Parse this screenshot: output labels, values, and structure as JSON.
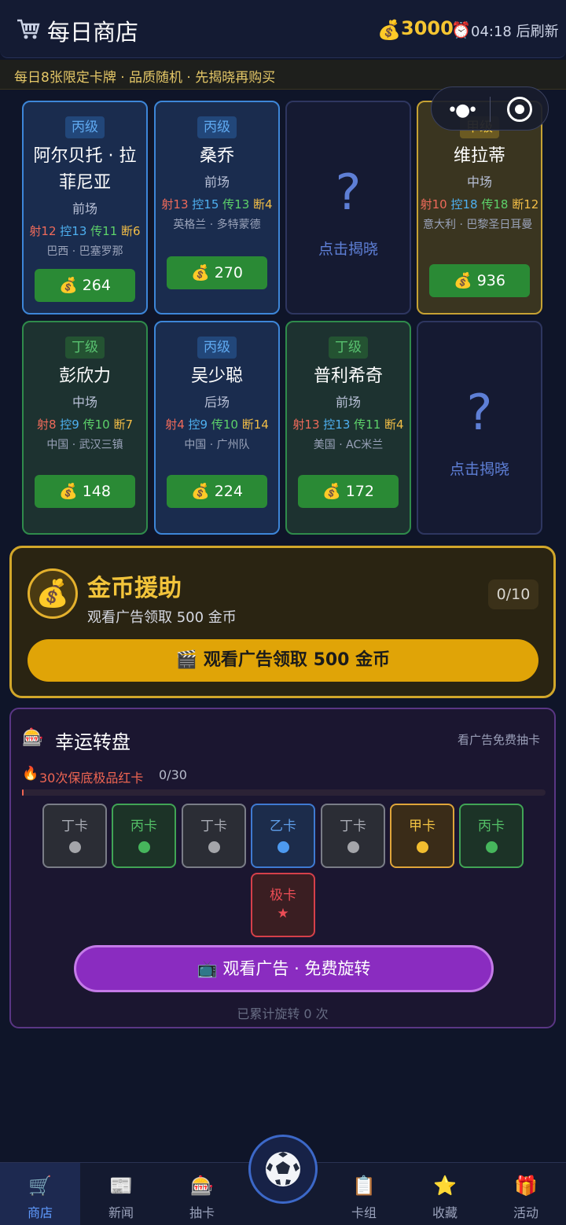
{
  "header": {
    "title": "每日商店",
    "coins": "3000",
    "refresh": "04:18 后刷新"
  },
  "ticker": "每日8张限定卡牌 · 品质随机 · 先揭晓再购买",
  "cards": [
    {
      "grade": "丙级",
      "name": "阿尔贝托 · 拉菲尼亚",
      "pos": "前场",
      "she": "射12",
      "kong": "控13",
      "chuan": "传11",
      "duan": "断6",
      "origin": "巴西 · 巴塞罗那",
      "price": "264"
    },
    {
      "grade": "丙级",
      "name": "桑乔",
      "pos": "前场",
      "she": "射13",
      "kong": "控15",
      "chuan": "传13",
      "duan": "断4",
      "origin": "英格兰 · 多特蒙德",
      "price": "270"
    },
    {
      "hidden": true,
      "reveal": "点击揭晓",
      "qmark": "?"
    },
    {
      "grade": "甲级",
      "name": "维拉蒂",
      "pos": "中场",
      "she": "射10",
      "kong": "控18",
      "chuan": "传18",
      "duan": "断12",
      "origin": "意大利 · 巴黎圣日耳曼",
      "price": "936"
    },
    {
      "grade": "丁级",
      "name": "彭欣力",
      "pos": "中场",
      "she": "射8",
      "kong": "控9",
      "chuan": "传10",
      "duan": "断7",
      "origin": "中国 · 武汉三镇",
      "price": "148"
    },
    {
      "grade": "丙级",
      "name": "吴少聪",
      "pos": "后场",
      "she": "射4",
      "kong": "控9",
      "chuan": "传10",
      "duan": "断14",
      "origin": "中国 · 广州队",
      "price": "224"
    },
    {
      "grade": "丁级",
      "name": "普利希奇",
      "pos": "前场",
      "she": "射13",
      "kong": "控13",
      "chuan": "传11",
      "duan": "断4",
      "origin": "美国 · AC米兰",
      "price": "172"
    },
    {
      "hidden": true,
      "reveal": "点击揭晓",
      "qmark": "?"
    }
  ],
  "assist": {
    "title": "金币援助",
    "subtitle": "观看广告领取 500 金币",
    "count": "0/10",
    "button": "观看广告领取 500 金币"
  },
  "wheel": {
    "title": "幸运转盘",
    "hint": "看广告免费抽卡",
    "guarantee": "30次保底极品红卡",
    "guarantee_count": "0/30",
    "guarantee_progress": 0,
    "slots": [
      {
        "label": "丁卡",
        "tier": "ding"
      },
      {
        "label": "丙卡",
        "tier": "bing"
      },
      {
        "label": "丁卡",
        "tier": "ding"
      },
      {
        "label": "乙卡",
        "tier": "yi"
      },
      {
        "label": "丁卡",
        "tier": "ding"
      },
      {
        "label": "甲卡",
        "tier": "jia"
      },
      {
        "label": "丙卡",
        "tier": "bing"
      },
      {
        "label": "极卡",
        "tier": "ji"
      }
    ],
    "button": "观看广告 · 免费旋转",
    "total": "已累计旋转 0 次"
  },
  "nav": [
    {
      "label": "商店",
      "icon": "cart-icon"
    },
    {
      "label": "新闻",
      "icon": "newspaper-icon"
    },
    {
      "label": "抽卡",
      "icon": "slot-machine-icon"
    },
    {
      "label": "",
      "icon": "soccer-ball-icon"
    },
    {
      "label": "卡组",
      "icon": "clipboard-icon"
    },
    {
      "label": "收藏",
      "icon": "star-icon"
    },
    {
      "label": "活动",
      "icon": "gift-icon"
    }
  ],
  "colors": {
    "background": "#0f1529",
    "coin": "#f5c531",
    "assist_button": "#e0a407",
    "wheel_button": "#8a2cc0",
    "nav_active": "#5f9bff"
  }
}
